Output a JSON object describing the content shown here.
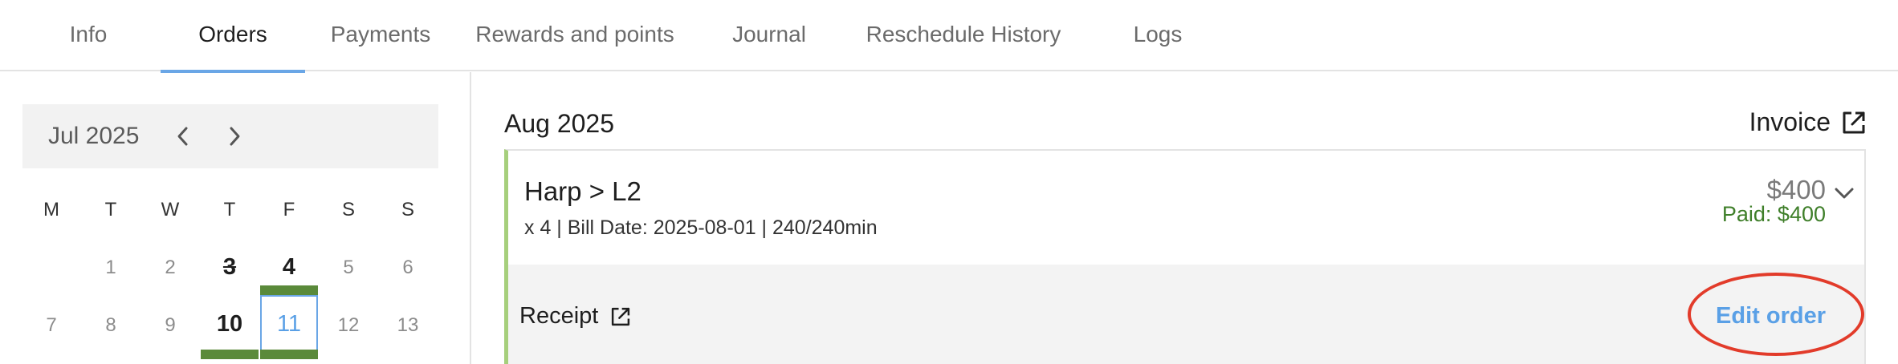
{
  "tabs": [
    {
      "label": "Info"
    },
    {
      "label": "Orders"
    },
    {
      "label": "Payments"
    },
    {
      "label": "Rewards and points"
    },
    {
      "label": "Journal"
    },
    {
      "label": "Reschedule History"
    },
    {
      "label": "Logs"
    }
  ],
  "active_tab": "Orders",
  "calendar": {
    "month_label": "Jul 2025",
    "weekdays": [
      "M",
      "T",
      "W",
      "T",
      "F",
      "S",
      "S"
    ],
    "days": [
      "1",
      "2",
      "3",
      "4",
      "5",
      "6",
      "7",
      "8",
      "9",
      "10",
      "11",
      "12",
      "13"
    ],
    "selected_day": "11",
    "colors": {
      "lesson_bar": "#5a8a3a",
      "selection": "#6aa6e6"
    }
  },
  "orders": {
    "period_title": "Aug 2025",
    "invoice_label": "Invoice",
    "order": {
      "title": "Harp > L2",
      "details": "x 4 | Bill Date: 2025-08-01 | 240/240min",
      "price": "$400",
      "paid": "Paid: $400",
      "receipt_label": "Receipt",
      "edit_label": "Edit order"
    }
  },
  "colors": {
    "accent": "#6aa6e6",
    "paid_green": "#3f7f2a",
    "card_left_border": "#a6cf7c",
    "annotation_red": "#e23b2a"
  }
}
